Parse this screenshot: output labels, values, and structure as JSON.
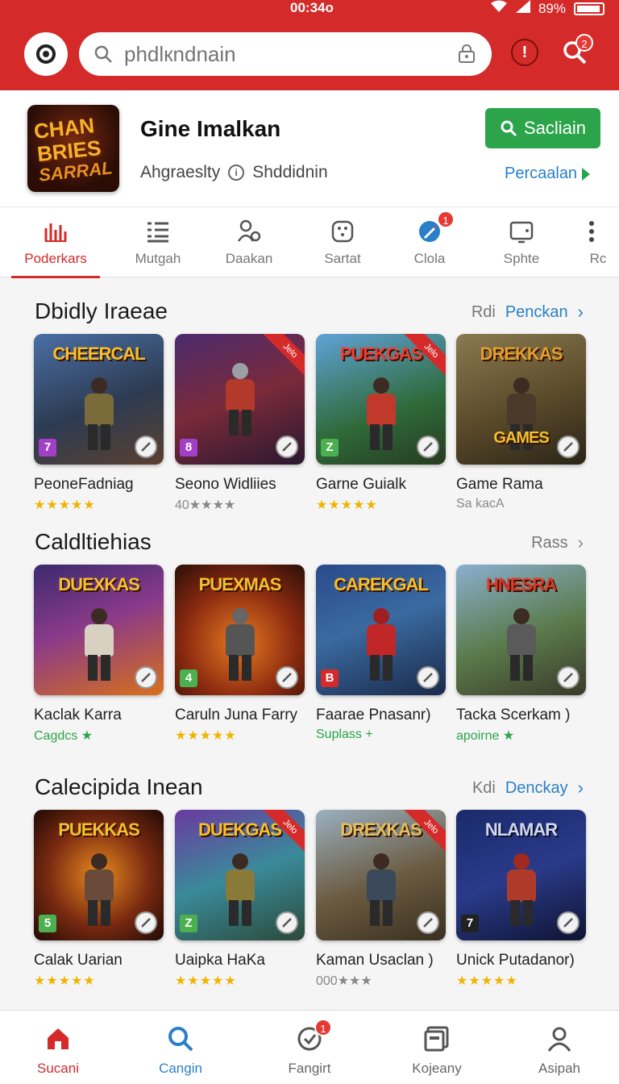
{
  "status": {
    "time": "00:34o",
    "battery": "89%"
  },
  "header": {
    "search_placeholder": "phdlкndnain",
    "alert_icon": "!",
    "notif_count": "2"
  },
  "app": {
    "icon_line1": "CHAN",
    "icon_line2": "BRIES",
    "icon_line3": "SARRAL",
    "title": "Gine Imalkan",
    "subtitle_left": "Ahgraeslty",
    "subtitle_right": "Shddidnin",
    "primary_button": "Sacliain",
    "link": "Percaalan"
  },
  "tabs": [
    {
      "label": "Poderkars",
      "icon": "chart-icon"
    },
    {
      "label": "Mutgah",
      "icon": "list-icon"
    },
    {
      "label": "Daakan",
      "icon": "people-icon"
    },
    {
      "label": "Sartat",
      "icon": "dice-icon"
    },
    {
      "label": "Clola",
      "icon": "rocket-icon",
      "badge": "1"
    },
    {
      "label": "Sphte",
      "icon": "tablet-icon"
    },
    {
      "label": "Rc",
      "icon": "more-icon"
    }
  ],
  "sections": [
    {
      "title": "Dbidly Iraeae",
      "more_grey": "Rdi",
      "more_blue": "Penckan",
      "cards": [
        {
          "art": "CHEERCAL",
          "badge": "7",
          "name": "PeoneFadniag",
          "sub": "★★★★★",
          "sub_style": "stars"
        },
        {
          "art": "",
          "badge": "8",
          "name": "Seono Widliies",
          "sub": "40★★★★",
          "sub_style": "grey",
          "ribbon": "Jelo"
        },
        {
          "art": "PUEKGAS",
          "badge": "Z",
          "name": "Garne Guialk",
          "sub": "★★★★★",
          "sub_style": "stars",
          "ribbon": "Jelo"
        },
        {
          "art": "DREKKAS",
          "badge": "",
          "name": "Game Rama",
          "sub": "Sa kacA",
          "sub_style": "grey",
          "art2": "GAMES"
        }
      ]
    },
    {
      "title": "Caldltiehias",
      "more_grey": "Rass",
      "more_blue": "",
      "cards": [
        {
          "art": "DUEXKAS",
          "badge": "",
          "name": "Kaclak Karra",
          "sub": "Cagdcs ★",
          "sub_style": "green"
        },
        {
          "art": "PUEXMAS",
          "badge": "4",
          "name": "Caruln Juna Farry",
          "sub": "★★★★★",
          "sub_style": "stars"
        },
        {
          "art": "CAREKGAL",
          "badge": "B",
          "name": "Faarae Pnasanr)",
          "sub": "Suplass +",
          "sub_style": "green"
        },
        {
          "art": "HNESRA",
          "badge": "",
          "name": "Tacka Scerkam )",
          "sub": "apoirne ★",
          "sub_style": "green"
        }
      ]
    },
    {
      "title": "Calecipida Inean",
      "more_grey": "Kdi",
      "more_blue": "Denckay",
      "cards": [
        {
          "art": "PUEKKAS",
          "badge": "5",
          "name": "Calak Uarian",
          "sub": "★★★★★",
          "sub_style": "stars"
        },
        {
          "art": "DUEKGAS",
          "badge": "Z",
          "name": "Uaipka HaKa",
          "sub": "★★★★★",
          "sub_style": "stars",
          "ribbon": "Jelo"
        },
        {
          "art": "DREXKAS",
          "badge": "",
          "name": "Kaman Usaclan )",
          "sub": "000★★★",
          "sub_style": "grey",
          "ribbon": "Jelo"
        },
        {
          "art": "NLAMAR",
          "badge": "7",
          "name": "Unick Putadanor)",
          "sub": "★★★★★",
          "sub_style": "stars"
        }
      ]
    }
  ],
  "bottom_nav": [
    {
      "label": "Sucani",
      "icon": "home-icon"
    },
    {
      "label": "Cangin",
      "icon": "search-icon"
    },
    {
      "label": "Fangirt",
      "icon": "clock-icon",
      "badge": "1"
    },
    {
      "label": "Kojeany",
      "icon": "library-icon"
    },
    {
      "label": "Asipah",
      "icon": "profile-icon"
    }
  ],
  "colors": {
    "brand_red": "#d52a2a",
    "install_green": "#2ba44a",
    "link_blue": "#2a7fc8",
    "star_gold": "#f0b400"
  }
}
